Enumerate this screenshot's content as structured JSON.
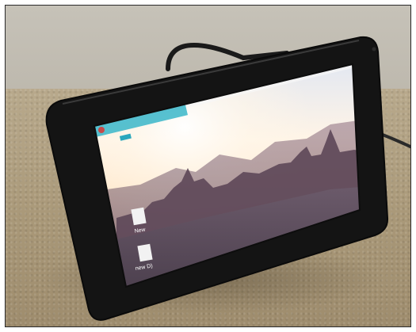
{
  "photo": {
    "subject": "tablet-display-on-desk",
    "colors": {
      "bezel": "#141414",
      "sky_top": "#dfe6f3",
      "sunset": "#ffe8cc",
      "mountains": "#7a5a6e",
      "desk": "#a99878",
      "toolbar_highlight": "#39b6c9"
    }
  },
  "screen": {
    "desktop_icons": [
      {
        "label": "New"
      },
      {
        "label": "new D)"
      }
    ]
  }
}
